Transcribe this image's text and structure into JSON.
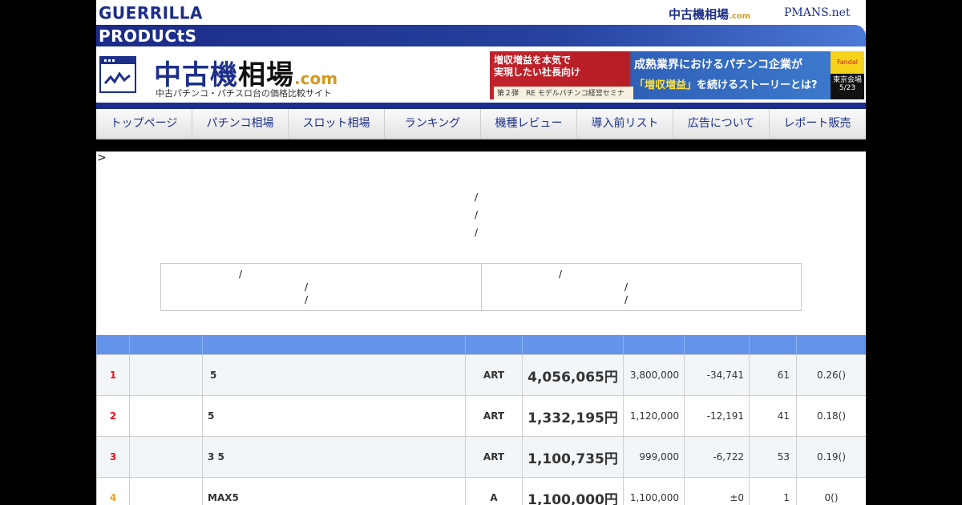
{
  "header": {
    "brand_line1": "GUERRILLA",
    "brand_line2": "PRODUCtS",
    "site_link_main": "中古機相場",
    "site_link_com": ".com",
    "pmans_link": "PMANS.net",
    "site_title_a": "中古機",
    "site_title_b": "相場",
    "site_title_com": ".com",
    "site_subtitle": "中古パチンコ・パチスロ台の価格比較サイト"
  },
  "banner": {
    "left_line1": "増収増益を本気で",
    "left_line2": "実現したい社長向け",
    "left_line3": "第２弾　RE モデルパチンコ経営セミナー",
    "right_line1": "成熟業界におけるパチンコ企業が",
    "right_hl": "「増収増益」",
    "right_line2": "を続けるストーリーとは?",
    "side_top": "Fandal",
    "side_venue": "東京会場",
    "side_date": "5/23"
  },
  "nav": {
    "items": [
      {
        "label": "トップページ"
      },
      {
        "label": "パチンコ相場"
      },
      {
        "label": "スロット相場"
      },
      {
        "label": "ランキング"
      },
      {
        "label": "機種レビュー"
      },
      {
        "label": "導入前リスト"
      },
      {
        "label": "広告について"
      },
      {
        "label": "レポート販売"
      }
    ]
  },
  "breadcrumb": ">",
  "slash": "/",
  "ranking": {
    "rows": [
      {
        "rank": "1",
        "name": "5",
        "type": "ART",
        "price": "4,056,065円",
        "prev": "3,800,000",
        "diff": "-34,741",
        "count": "61",
        "ratio": "0.26()"
      },
      {
        "rank": "2",
        "name": "5",
        "type": "ART",
        "price": "1,332,195円",
        "prev": "1,120,000",
        "diff": "-12,191",
        "count": "41",
        "ratio": "0.18()"
      },
      {
        "rank": "3",
        "name": "3 5",
        "type": "ART",
        "price": "1,100,735円",
        "prev": "999,000",
        "diff": "-6,722",
        "count": "53",
        "ratio": "0.19()"
      },
      {
        "rank": "4",
        "name": "MAX5",
        "type": "A",
        "price": "1,100,000円",
        "prev": "1,100,000",
        "diff": "±0",
        "count": "1",
        "ratio": "0()"
      }
    ]
  },
  "colors": {
    "accent": "#1c2f8a",
    "table_header": "#6493ea",
    "price": "#e3131b",
    "rank_red": "#e3131b",
    "rank_orange": "#e8a21b"
  }
}
